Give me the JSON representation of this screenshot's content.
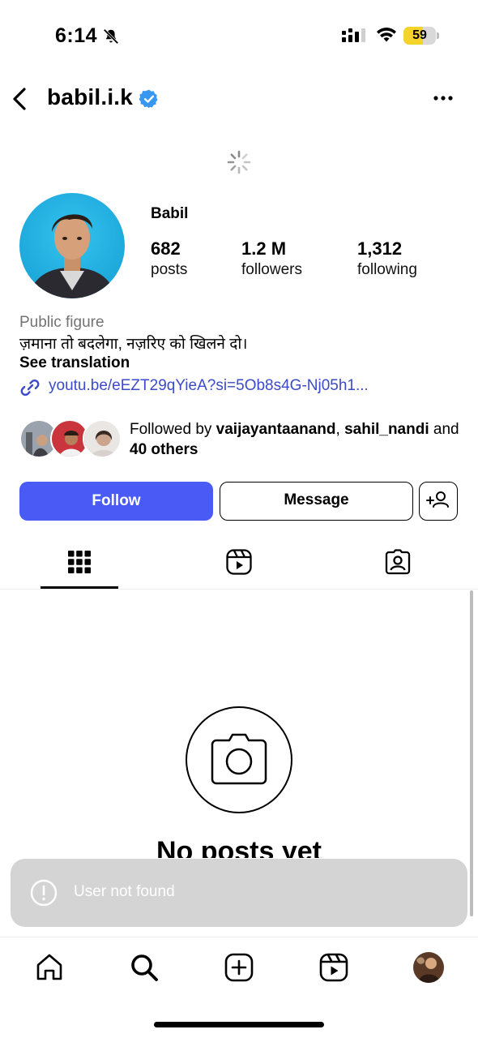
{
  "status_bar": {
    "time": "6:14",
    "battery_level": "59",
    "battery_fraction": 0.59,
    "icons": [
      "bell-slash-icon",
      "signal-icon",
      "wifi-icon",
      "battery-icon"
    ]
  },
  "header": {
    "username": "babil.i.k",
    "verified": true,
    "icons": [
      "chevron-left-icon",
      "verified-badge-icon",
      "more-horizontal-icon"
    ]
  },
  "profile": {
    "display_name": "Babil",
    "stats": [
      {
        "value": "682",
        "label": "posts"
      },
      {
        "value": "1.2 M",
        "label": "followers"
      },
      {
        "value": "1,312",
        "label": "following"
      }
    ],
    "category": "Public figure",
    "bio": "ज़माना तो बदलेगा, नज़रिए को खिलने दो।",
    "see_translation": "See translation",
    "link": "youtu.be/eEZT29qYieA?si=5Ob8s4G-Nj05h1...",
    "followed_by": {
      "prefix": "Followed by ",
      "user1": "vaijayantaanand",
      "separator": ", ",
      "user2": "sahil_nandi",
      "and": " and ",
      "others": "40 others"
    }
  },
  "actions": {
    "follow_label": "Follow",
    "message_label": "Message",
    "add_user_icon": "add-person-icon"
  },
  "tabs": [
    {
      "name": "posts",
      "icon": "grid-icon",
      "active": true
    },
    {
      "name": "reels",
      "icon": "reels-icon",
      "active": false
    },
    {
      "name": "tagged",
      "icon": "tagged-icon",
      "active": false
    }
  ],
  "empty_state": {
    "title": "No posts yet",
    "icon": "camera-icon"
  },
  "toast": {
    "message": "User not found",
    "icon": "alert-circle-icon"
  },
  "bottom_nav": [
    {
      "name": "home",
      "icon": "home-icon"
    },
    {
      "name": "search",
      "icon": "search-icon"
    },
    {
      "name": "create",
      "icon": "plus-square-icon"
    },
    {
      "name": "reels",
      "icon": "reels-icon"
    },
    {
      "name": "profile",
      "icon": "profile-avatar"
    }
  ],
  "colors": {
    "follow_button": "#4a5bf5",
    "link": "#3b4bc9",
    "verified": "#3897f0",
    "battery": "#f6d32a",
    "toast_bg": "#d4d4d4",
    "secondary_text": "#737373"
  }
}
